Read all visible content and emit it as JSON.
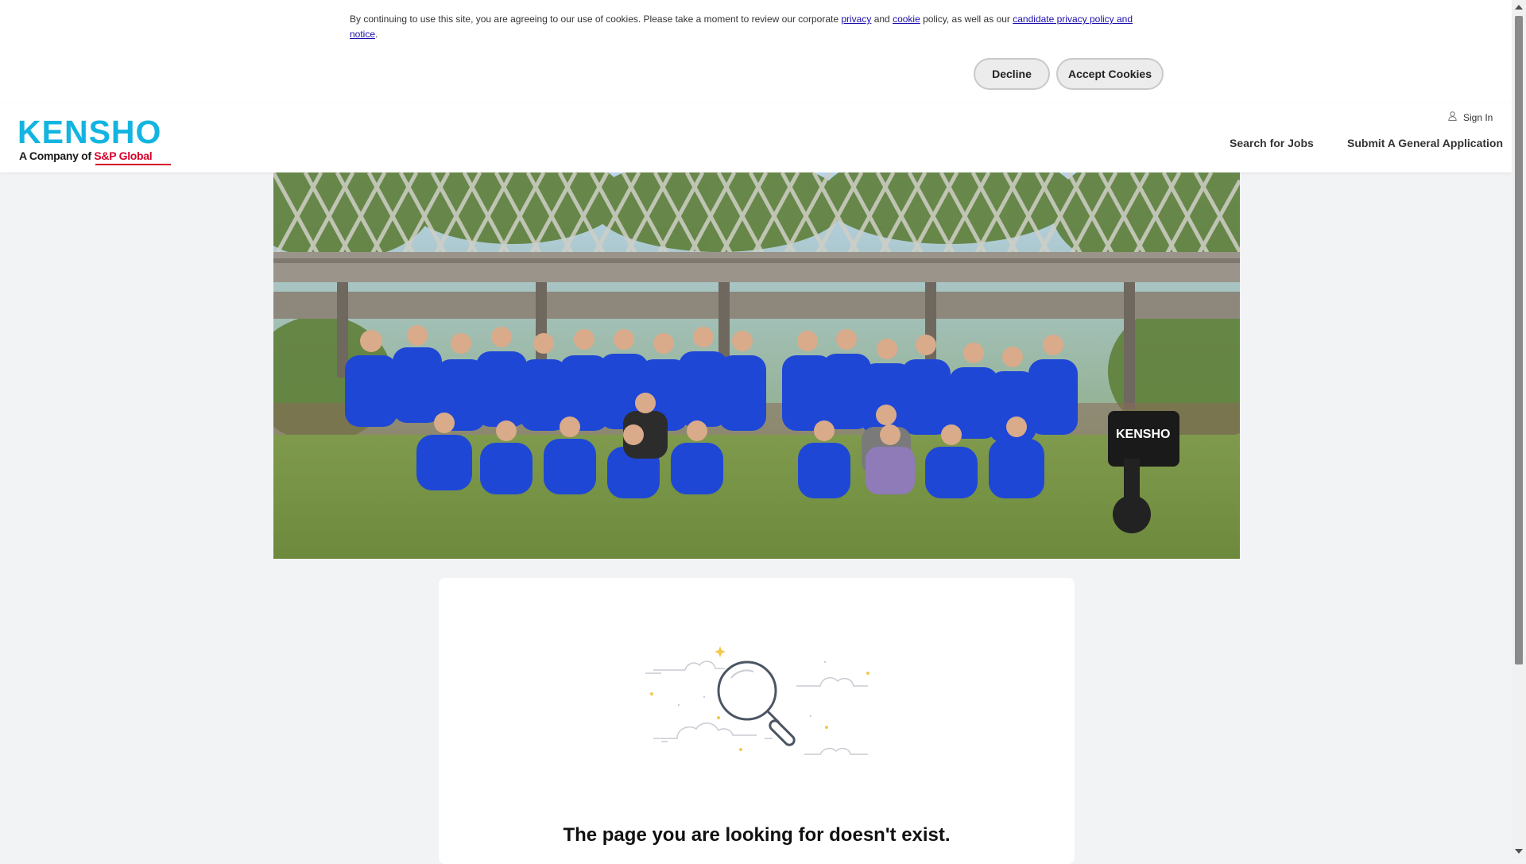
{
  "cookie_banner": {
    "text_before": "By continuing to use this site, you are agreeing to our use of cookies. Please take a moment to review our corporate ",
    "privacy_link": "privacy",
    "text_and": " and ",
    "cookie_link": "cookie",
    "text_policy": " policy, as well as our ",
    "candidate_link": "candidate privacy policy and notice",
    "text_end": ".",
    "decline_label": "Decline",
    "accept_label": "Accept Cookies"
  },
  "header": {
    "logo_main": "KENSHO",
    "logo_company_prefix": "A Company of ",
    "logo_company_brand": "S&P Global",
    "sign_in_label": "Sign In",
    "nav": {
      "search_jobs": "Search for Jobs",
      "general_application": "Submit A General Application"
    }
  },
  "hero": {
    "alt": "Team group photo"
  },
  "card": {
    "message": "The page you are looking for doesn't exist."
  },
  "colors": {
    "brand_blue": "#13b5e0",
    "brand_red": "#d6002a",
    "page_bg": "#f2f3f5",
    "shirt_blue": "#1f47d6"
  },
  "icons": {
    "sign_in": "user-icon",
    "illustration": "magnifying-glass-icon"
  }
}
